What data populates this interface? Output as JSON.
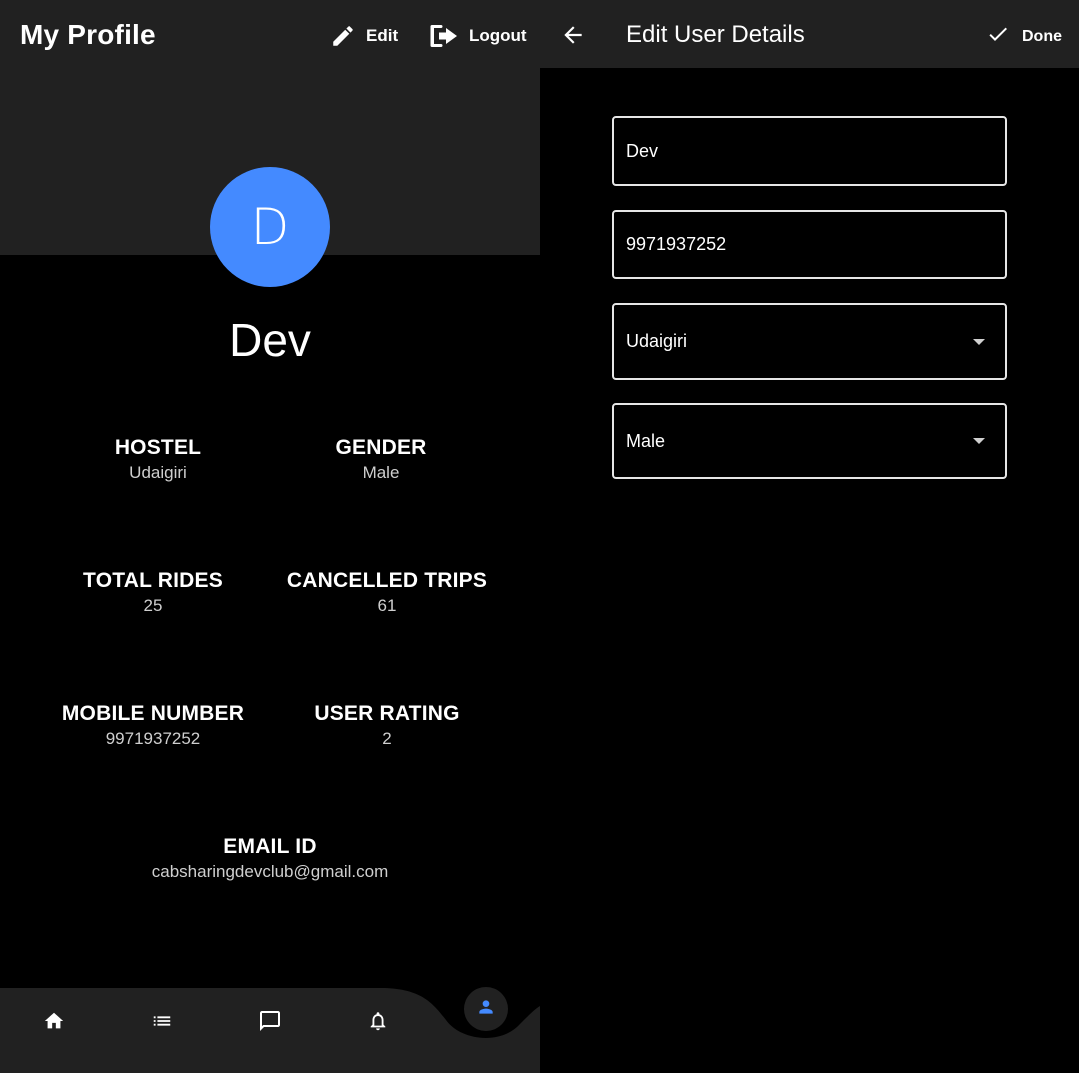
{
  "profile": {
    "title": "My Profile",
    "edit_label": "Edit",
    "logout_label": "Logout",
    "avatar_letter": "D",
    "name": "Dev",
    "stats": {
      "hostel": {
        "label": "HOSTEL",
        "value": "Udaigiri"
      },
      "gender": {
        "label": "GENDER",
        "value": "Male"
      },
      "total_rides": {
        "label": "TOTAL RIDES",
        "value": "25"
      },
      "cancelled_trips": {
        "label": "CANCELLED TRIPS",
        "value": "61"
      },
      "mobile": {
        "label": "MOBILE NUMBER",
        "value": "9971937252"
      },
      "rating": {
        "label": "USER RATING",
        "value": "2"
      },
      "email": {
        "label": "EMAIL ID",
        "value": "cabsharingdevclub@gmail.com"
      }
    },
    "nav": {
      "items": [
        "home-icon",
        "list-icon",
        "chat-icon",
        "bell-icon",
        "person-icon"
      ],
      "active": "person-icon"
    }
  },
  "edit": {
    "title": "Edit User Details",
    "done_label": "Done",
    "fields": {
      "name": "Dev",
      "phone": "9971937252",
      "hostel": "Udaigiri",
      "gender": "Male"
    }
  },
  "colors": {
    "appbar": "#212121",
    "background": "#000000",
    "accent": "#448aff",
    "text": "#ffffff",
    "muted_text": "#cfcfcf",
    "field_border": "#e6e6e6"
  }
}
